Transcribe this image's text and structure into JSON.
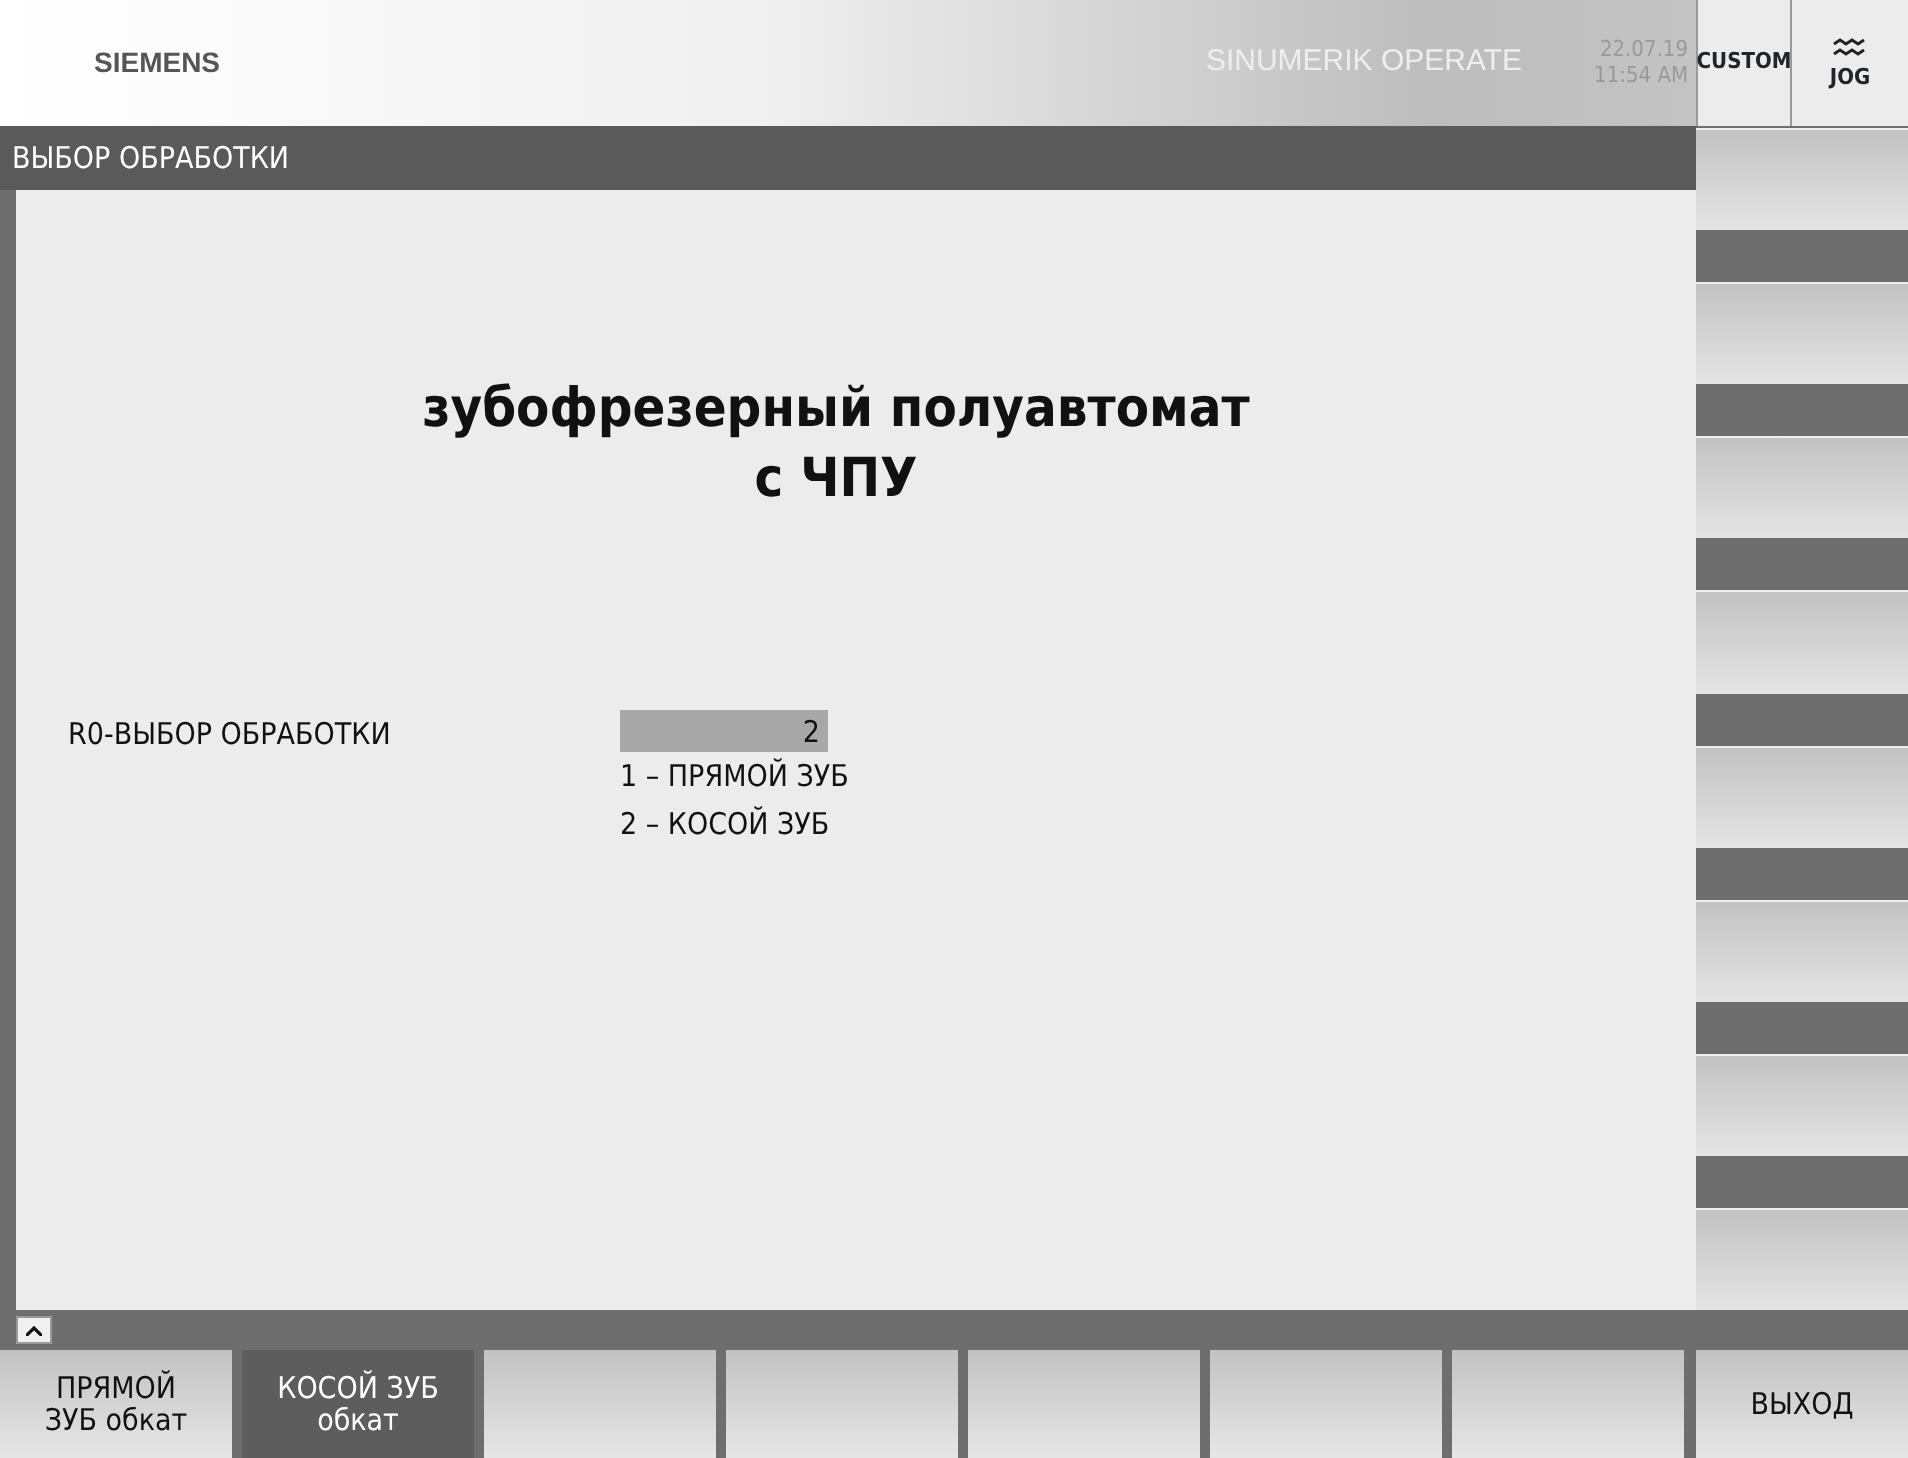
{
  "header": {
    "brand": "SIEMENS",
    "product": "SINUMERIK OPERATE",
    "date": "22.07.19",
    "time": "11:54 AM",
    "area": "CUSTOM",
    "mode": "JOG"
  },
  "title": "ВЫБОР ОБРАБОТКИ",
  "heading": [
    "зубофрезерный полуавтомат",
    "с ЧПУ"
  ],
  "parameter": {
    "label": "R0-ВЫБОР ОБРАБОТКИ",
    "value": "2",
    "options": [
      "1 – ПРЯМОЙ ЗУБ",
      "2 – КОСОЙ ЗУБ"
    ]
  },
  "vertical_softkeys": [
    {
      "selected": false
    },
    {
      "selected": false
    },
    {
      "selected": false
    },
    {
      "selected": false
    },
    {
      "selected": false
    },
    {
      "selected": false
    },
    {
      "selected": false
    },
    {
      "selected": false
    }
  ],
  "horizontal_softkeys": [
    {
      "lines": [
        "ПРЯМОЙ",
        "ЗУБ обкат"
      ],
      "selected": false
    },
    {
      "lines": [
        "КОСОЙ ЗУБ",
        "обкат"
      ],
      "selected": true
    },
    {
      "selected": false
    },
    {
      "selected": false
    },
    {
      "selected": false
    },
    {
      "selected": false
    },
    {
      "selected": false
    }
  ],
  "exit_softkey": "ВЫХОД"
}
